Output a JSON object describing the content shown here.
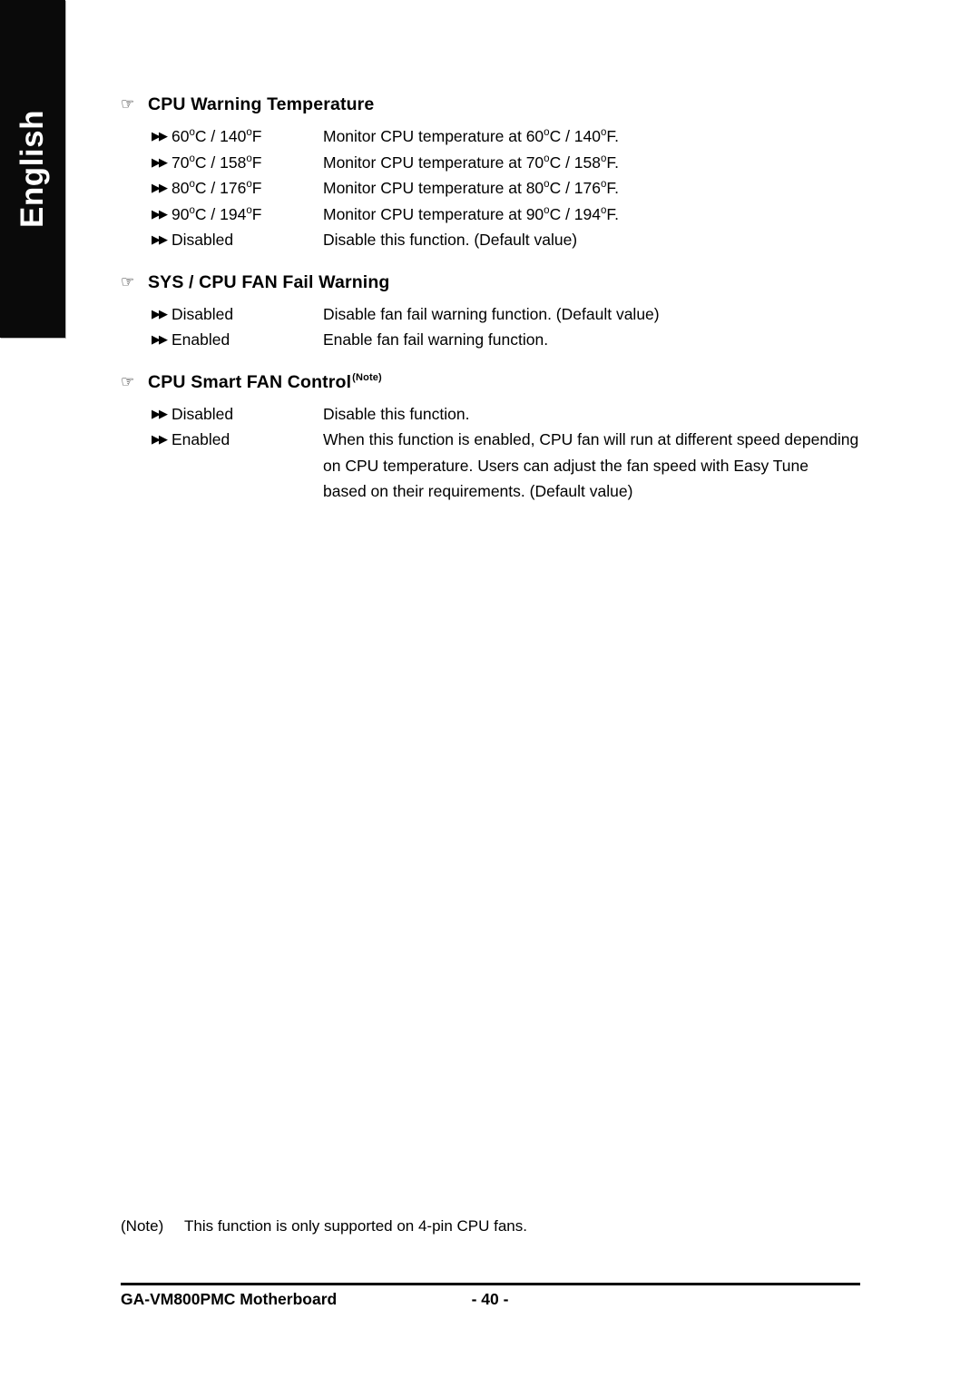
{
  "sidebar": {
    "language_tab": "English"
  },
  "page": {
    "sections": [
      {
        "icon": "pointing-hand-icon",
        "heading": "CPU Warning Temperature",
        "note_marker": "",
        "options": [
          {
            "bullet": "double-arrow-icon",
            "name_pre": "60",
            "name_mid": "C / 140",
            "name_post": "F",
            "desc_pre": "Monitor CPU temperature at 60",
            "desc_mid": "C / 140",
            "desc_post": "F."
          },
          {
            "bullet": "double-arrow-icon",
            "name_pre": "70",
            "name_mid": "C / 158",
            "name_post": "F",
            "desc_pre": "Monitor CPU temperature at 70",
            "desc_mid": "C / 158",
            "desc_post": "F."
          },
          {
            "bullet": "double-arrow-icon",
            "name_pre": "80",
            "name_mid": "C / 176",
            "name_post": "F",
            "desc_pre": "Monitor CPU temperature at 80",
            "desc_mid": "C / 176",
            "desc_post": "F."
          },
          {
            "bullet": "double-arrow-icon",
            "name_pre": "90",
            "name_mid": "C / 194",
            "name_post": "F",
            "desc_pre": "Monitor CPU temperature at 90",
            "desc_mid": "C / 194",
            "desc_post": "F."
          },
          {
            "bullet": "double-arrow-icon",
            "name": "Disabled",
            "desc": "Disable this function. (Default value)"
          }
        ]
      },
      {
        "icon": "pointing-hand-icon",
        "heading": "SYS / CPU FAN Fail Warning",
        "note_marker": "",
        "options": [
          {
            "bullet": "double-arrow-icon",
            "name": "Disabled",
            "desc": "Disable fan fail warning function. (Default value)"
          },
          {
            "bullet": "double-arrow-icon",
            "name": "Enabled",
            "desc": "Enable fan fail warning function."
          }
        ]
      },
      {
        "icon": "pointing-hand-icon",
        "heading": "CPU Smart FAN Control",
        "note_marker": "(Note)",
        "options": [
          {
            "bullet": "double-arrow-icon",
            "name": "Disabled",
            "desc": "Disable this function."
          },
          {
            "bullet": "double-arrow-icon",
            "name": "Enabled",
            "desc": "When this function is enabled, CPU fan will run at different speed depending",
            "desc_line2": "on CPU temperature. Users can adjust the fan speed with Easy Tune",
            "desc_line3": "based on their requirements. (Default value)"
          }
        ]
      }
    ],
    "footnote": {
      "marker": "(Note)",
      "text": "This function is only supported on 4-pin CPU fans."
    },
    "footer": {
      "product": "GA-VM800PMC Motherboard",
      "page_number": "- 40 -"
    }
  },
  "glyphs": {
    "pointing_hand": "☞",
    "double_arrow": "▶▶",
    "degree": "o"
  }
}
